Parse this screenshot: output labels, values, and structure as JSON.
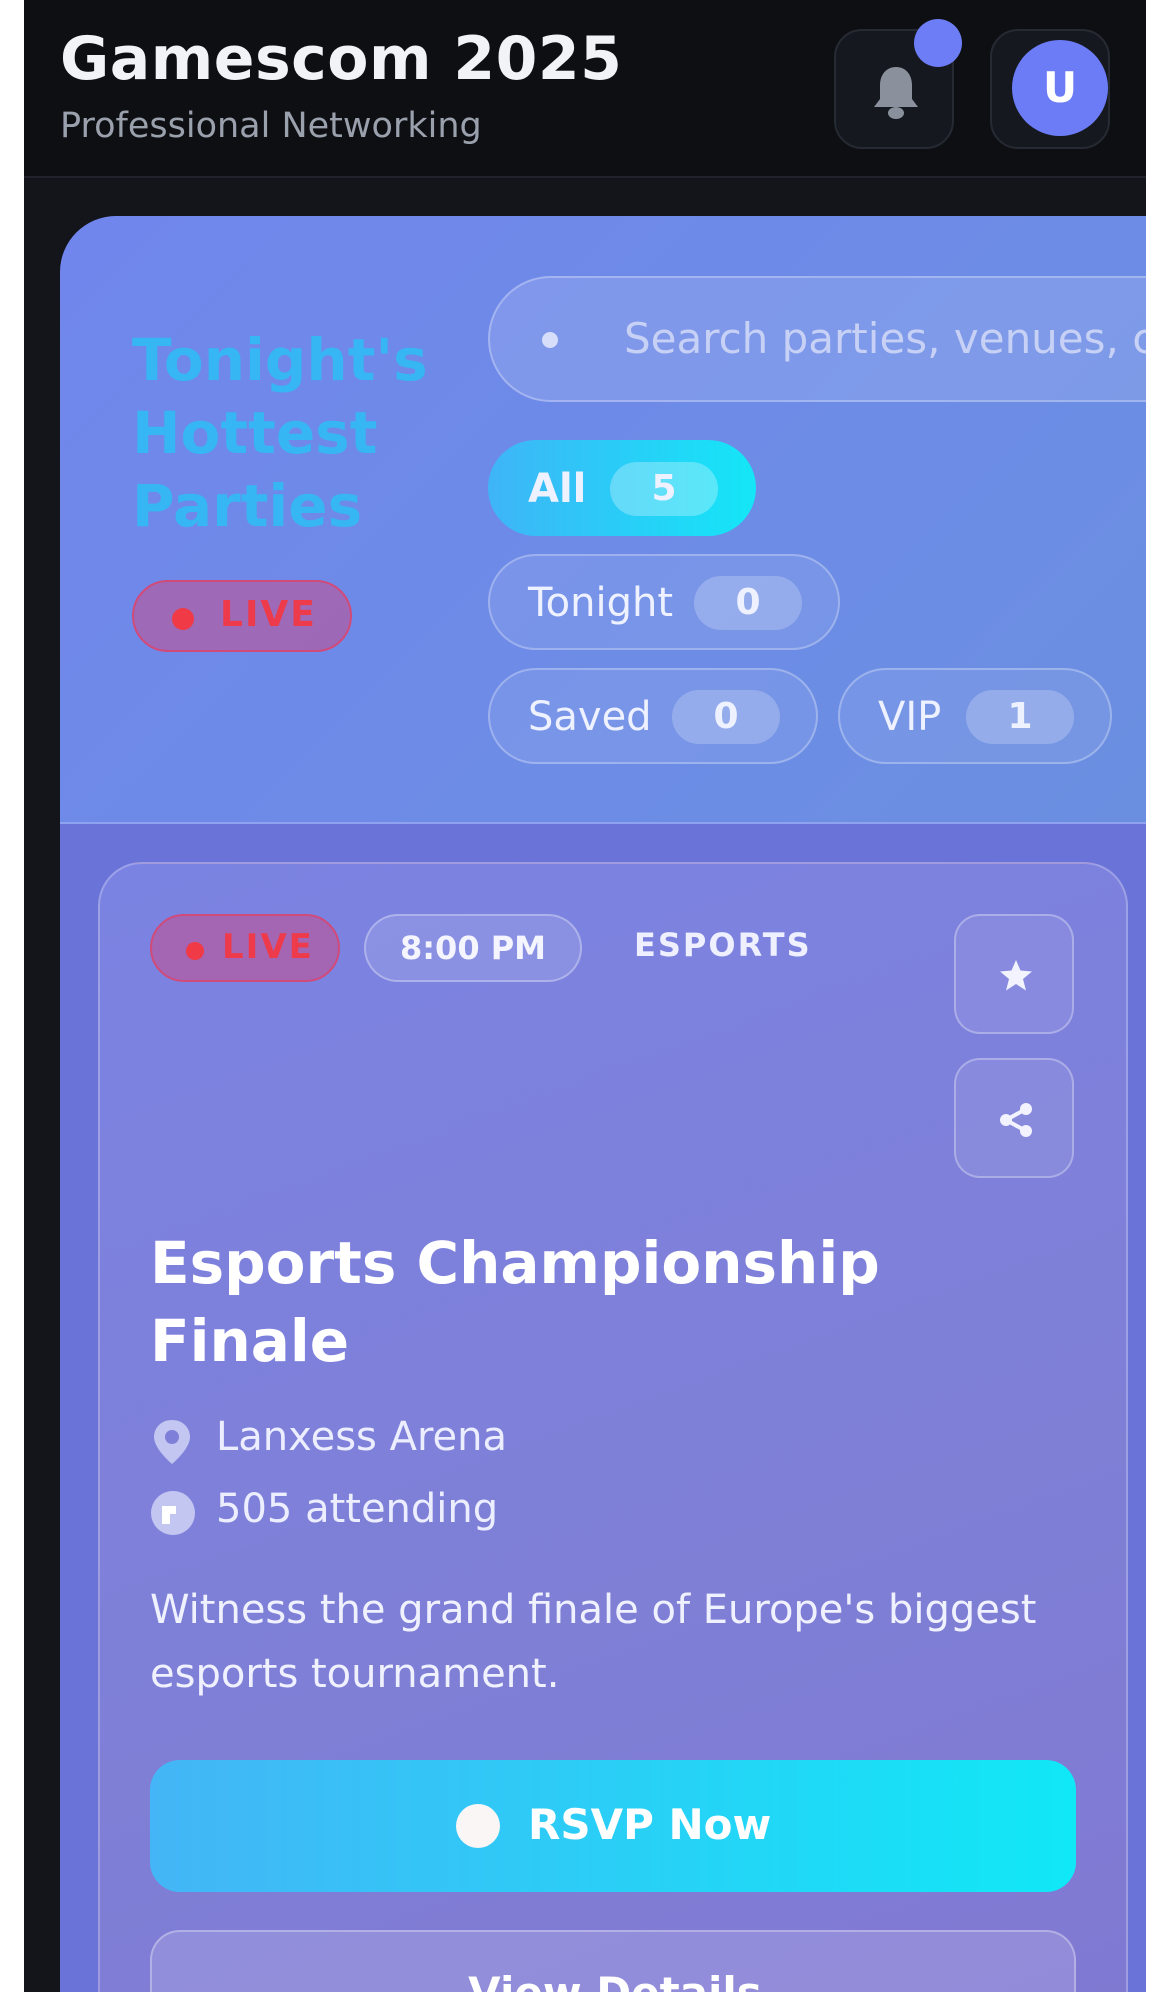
{
  "header": {
    "title": "Gamescom 2025",
    "subtitle": "Professional Networking",
    "avatar_initial": "U"
  },
  "hero": {
    "title": "Tonight's Hottest Parties",
    "live_label": "LIVE",
    "search_placeholder": "Search parties, venues, c",
    "filters": [
      {
        "label": "All",
        "count": "5",
        "active": true
      },
      {
        "label": "Tonight",
        "count": "0"
      },
      {
        "label": "Saved",
        "count": "0"
      },
      {
        "label": "VIP",
        "count": "1"
      }
    ]
  },
  "event": {
    "live_label": "LIVE",
    "time": "8:00 PM",
    "category": "ESPORTS",
    "title": "Esports Championship Finale",
    "venue": "Lanxess Arena",
    "attending": "505 attending",
    "description": "Witness the grand finale of Europe's biggest esports tournament.",
    "rsvp_label": "RSVP Now",
    "details_label": "View Details"
  },
  "icons": {
    "bell": "bell-icon",
    "star": "star-icon",
    "share": "share-icon",
    "location": "location-pin-icon",
    "attendees": "people-icon"
  },
  "colors": {
    "accent": "#6b7cf6",
    "live": "#ee3b4b",
    "hero_title": "#36b6f3",
    "cta_start": "#44b5f6",
    "cta_end": "#10e8f6"
  }
}
